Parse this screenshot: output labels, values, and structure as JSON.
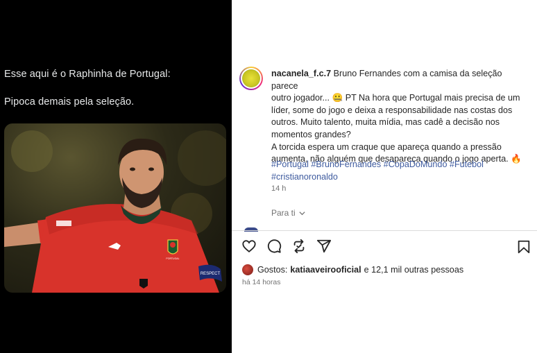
{
  "tweet": {
    "line1": "Esse aqui é o Raphinha de Portugal:",
    "line2": "Pipoca demais pela seleção."
  },
  "post": {
    "username": "nacanela_f.c.7",
    "avatar_label": "NaCanela FC",
    "caption_lines": [
      "Bruno Fernandes com a camisa da seleção parece",
      "outro jogador... 🤐 PT Na hora que Portugal mais precisa de um",
      "líder, some do jogo e deixa a responsabilidade nas costas dos",
      "outros. Muito talento, muita mídia, mas cadê a decisão nos",
      "momentos grandes?",
      "A torcida espera um craque que apareça quando a pressão",
      "aumenta, não alguém que desapareça quando o jogo aperta. 🔥"
    ],
    "hashtags_line1": "#Portugal #BrunoFernandes #CopaDoMundo #Futebol",
    "hashtags_line2": "#cristianoronaldo",
    "time_ago": "14 h",
    "for_you": "Para ti",
    "likes_prefix": "Gostos:",
    "liked_by": "katiaaveirooficial",
    "likes_suffix": "e 12,1 mil outras pessoas",
    "posted": "há 14 horas",
    "kit_crest_text": "PORTUGAL",
    "armband_text": "RESPECT"
  },
  "icons": {
    "like": "heart-icon",
    "comment": "comment-icon",
    "repost": "repost-icon",
    "share": "send-icon",
    "save": "bookmark-icon",
    "chevron": "chevron-down-icon"
  },
  "colors": {
    "left_bg": "#000000",
    "hashtag": "#3d5a9e",
    "jersey": "#d8332b"
  }
}
